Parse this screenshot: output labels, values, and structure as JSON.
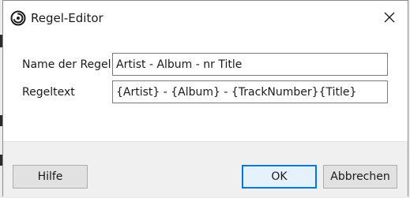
{
  "dialog": {
    "title": "Regel-Editor"
  },
  "fields": {
    "name": {
      "label": "Name der Regel",
      "value": "Artist - Album - nr Title"
    },
    "ruletext": {
      "label": "Regeltext",
      "value": "{Artist} - {Album} - {TrackNumber}{Title}"
    }
  },
  "buttons": {
    "help": "Hilfe",
    "ok": "OK",
    "cancel": "Abbrechen"
  },
  "icons": {
    "app": "app-logo-icon",
    "close": "close-icon"
  },
  "colors": {
    "accent": "#0078d7",
    "footer_bg": "#f0f0f0",
    "button_bg": "#e1e1e1"
  }
}
